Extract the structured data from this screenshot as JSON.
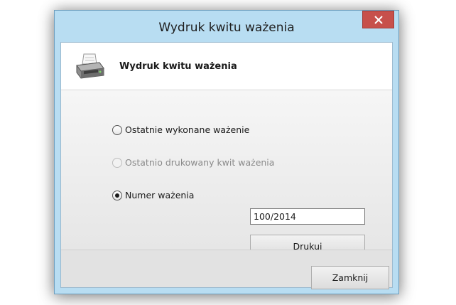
{
  "window": {
    "title": "Wydruk kwitu ważenia",
    "close_icon": "close-icon"
  },
  "header": {
    "icon": "printer-icon",
    "title": "Wydruk kwitu ważenia"
  },
  "options": {
    "last_weighing": {
      "label": "Ostatnie wykonane ważenie",
      "checked": false,
      "enabled": true
    },
    "last_printed": {
      "label": "Ostatnio drukowany kwit ważenia",
      "checked": false,
      "enabled": false
    },
    "weighing_number": {
      "label": "Numer ważenia",
      "checked": true,
      "enabled": true
    }
  },
  "number_input": {
    "value": "100/2014"
  },
  "buttons": {
    "print_label": "Drukuj",
    "close_label": "Zamknij"
  },
  "colors": {
    "titlebar": "#b8ddf2",
    "close_button": "#c7504b"
  }
}
